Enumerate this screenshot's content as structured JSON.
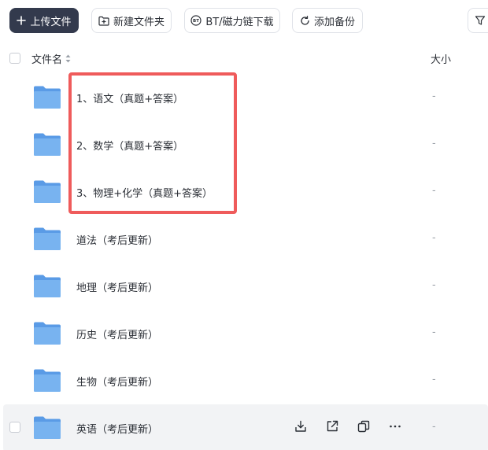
{
  "toolbar": {
    "upload_label": "上传文件",
    "new_folder_label": "新建文件夹",
    "bt_label": "BT/磁力链下载",
    "backup_label": "添加备份"
  },
  "header": {
    "name_label": "文件名",
    "size_label": "大小"
  },
  "files": [
    {
      "name": "1、语文（真题+答案）",
      "size": "-"
    },
    {
      "name": "2、数学（真题+答案）",
      "size": "-"
    },
    {
      "name": "3、物理+化学（真题+答案）",
      "size": "-"
    },
    {
      "name": "道法（考后更新）",
      "size": "-"
    },
    {
      "name": "地理（考后更新）",
      "size": "-"
    },
    {
      "name": "历史（考后更新）",
      "size": "-"
    },
    {
      "name": "生物（考后更新）",
      "size": "-"
    },
    {
      "name": "英语（考后更新）",
      "size": "-"
    }
  ],
  "colors": {
    "primary_button": "#333a4d",
    "folder": "#69a7ee",
    "highlight": "#ef5b5b"
  }
}
